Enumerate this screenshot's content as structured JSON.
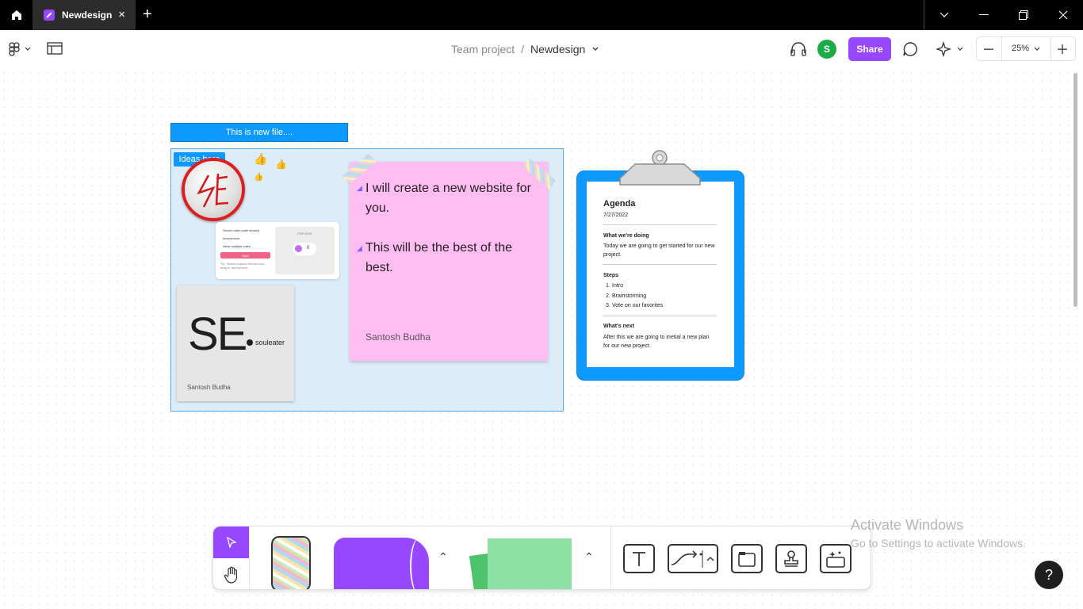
{
  "titlebar": {
    "tab_title": "Newdesign",
    "icons": [
      "home-icon",
      "close-icon",
      "plus-icon",
      "chevron-down-icon",
      "minimize-icon",
      "restore-icon",
      "close-window-icon"
    ]
  },
  "header": {
    "team": "Team project",
    "separator": "/",
    "file_name": "Newdesign",
    "avatar_initial": "S",
    "share_label": "Share",
    "zoom": "25%",
    "accent_color": "#9747ff"
  },
  "canvas": {
    "file_label": "This is new file....",
    "section_label": "Ideas here",
    "poll": {
      "line1": "Secret votes (until shown)",
      "line2": "Anonymous",
      "line3": "Allow multiple votes",
      "start_label": "Start",
      "note": "Tip: Switch support themes into drag or anonymous",
      "preview_label": "PREVIEW",
      "count": "0"
    },
    "logo_card": {
      "big": "SE",
      "sub": "souleater",
      "author": "Santosh Budha"
    },
    "sticky": {
      "line1": "I will create a new website for you.",
      "line2": "This will be the best of the best.",
      "author": "Santosh Budha"
    },
    "agenda": {
      "title": "Agenda",
      "date": "7/27/2022",
      "doing_heading": "What we're doing",
      "doing_text": "Today we are going to get started for our new project.",
      "steps_heading": "Steps",
      "steps": [
        "Intro",
        "Brainstorming",
        "Vote on our favorites"
      ],
      "next_heading": "What's next",
      "next_text": "After this we are going to inetial a new plan for our new project."
    }
  },
  "watermark": {
    "line1": "Activate Windows",
    "line2": "Go to Settings to activate Windows."
  },
  "help_label": "?"
}
